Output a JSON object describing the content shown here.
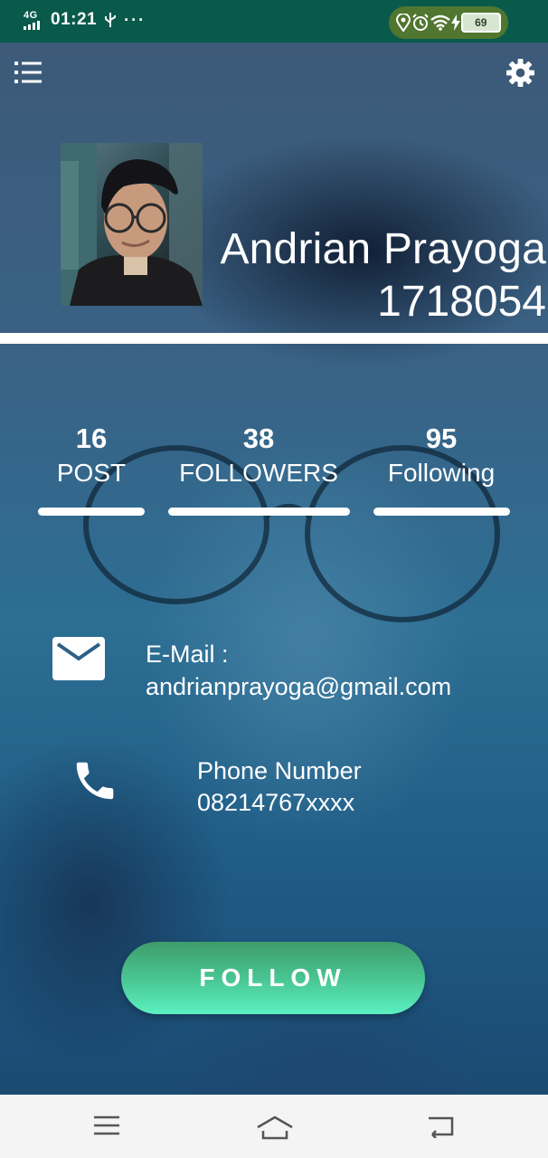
{
  "status_bar": {
    "network": "4G",
    "time": "01:21",
    "battery": "69",
    "icons": [
      "usb-icon",
      "more-icon",
      "location-icon",
      "alarm-icon",
      "wifi-icon",
      "charging-icon"
    ]
  },
  "toolbar": {
    "menu_icon": "menu-list-icon",
    "settings_icon": "gear-icon"
  },
  "profile": {
    "name": "Andrian Prayoga",
    "id": "1718054"
  },
  "stats": [
    {
      "count": "16",
      "label": "POST"
    },
    {
      "count": "38",
      "label": "FOLLOWERS"
    },
    {
      "count": "95",
      "label": "Following"
    }
  ],
  "contact": {
    "email_label": "E-Mail :",
    "email": "andrianprayoga@gmail.com",
    "phone_label": "Phone Number",
    "phone": "08214767xxxx"
  },
  "follow_button": {
    "label": "FOLLOW"
  },
  "colors": {
    "status_bar": "#0a5a4c",
    "accent_green": "#47c08d",
    "text": "#ffffff"
  }
}
